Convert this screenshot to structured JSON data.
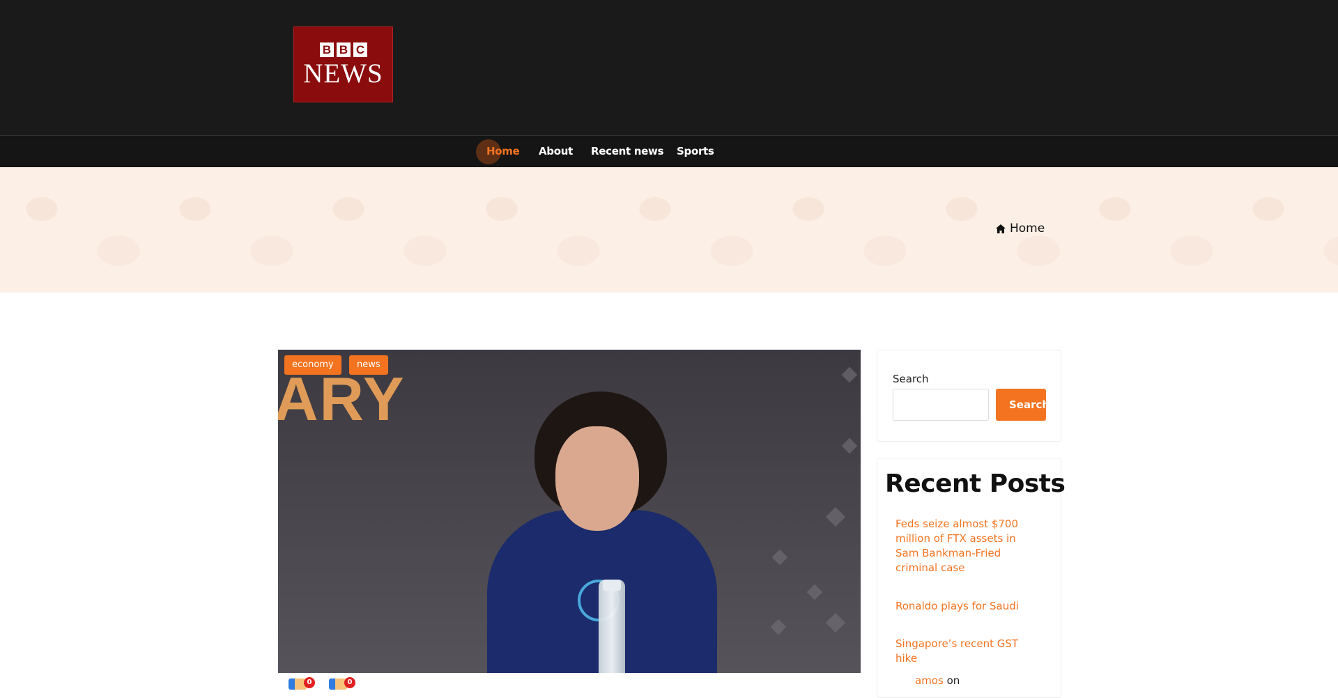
{
  "logo": {
    "bbc_letters": [
      "B",
      "B",
      "C"
    ],
    "news_text": "NEWS"
  },
  "nav": {
    "items": [
      {
        "label": "Home",
        "active": true
      },
      {
        "label": "About"
      },
      {
        "label": "Recent news"
      },
      {
        "label": "Sports"
      }
    ]
  },
  "breadcrumb": {
    "label": "Home",
    "icon": "home-icon"
  },
  "post": {
    "image_text": "ARY",
    "tags": [
      "economy",
      "news"
    ],
    "reactions": [
      {
        "icon": "like-icon",
        "count": "0"
      },
      {
        "icon": "dislike-icon",
        "count": "0"
      }
    ]
  },
  "sidebar": {
    "search": {
      "label": "Search",
      "button_label": "Search",
      "placeholder": ""
    },
    "recent_posts": {
      "title": "Recent Posts",
      "items": [
        "Feds seize almost $700 million of FTX assets in Sam Bankman-Fried criminal case",
        "Ronaldo plays for Saudi",
        "Singapore’s recent GST hike"
      ],
      "comment": {
        "author": "amos",
        "on": "on"
      }
    }
  },
  "colors": {
    "accent": "#f37320",
    "header_bg": "#1a1a1a",
    "banner_bg": "#fcefe6",
    "logo_red": "#8b0c0c"
  }
}
